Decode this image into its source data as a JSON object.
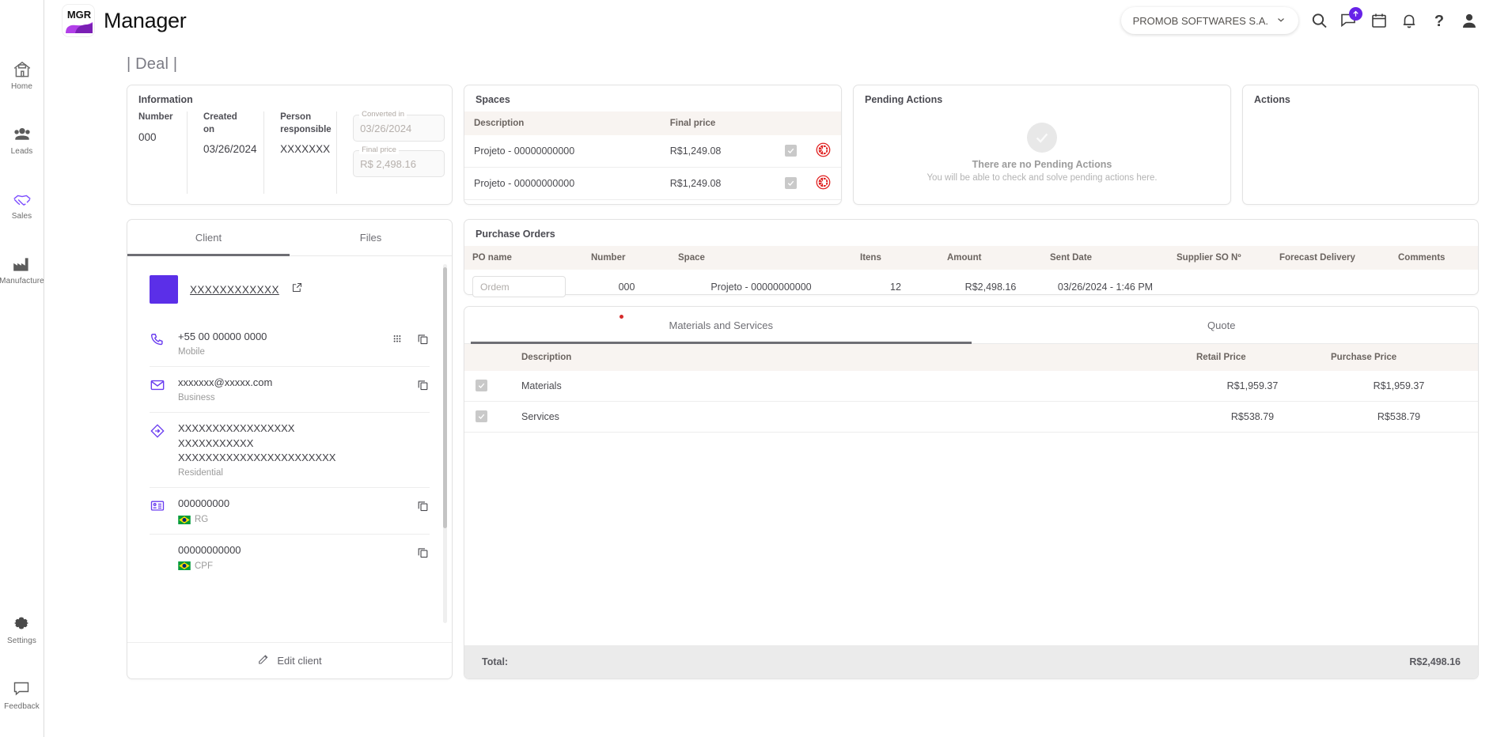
{
  "app": {
    "logo_text": "MGR",
    "title": "Manager"
  },
  "sidebar": {
    "items": [
      {
        "label": "Home",
        "icon": "home-icon"
      },
      {
        "label": "Leads",
        "icon": "people-icon"
      },
      {
        "label": "Sales",
        "icon": "handshake-icon"
      },
      {
        "label": "Manufacture",
        "icon": "factory-icon"
      }
    ],
    "bottom_items": [
      {
        "label": "Settings",
        "icon": "gear-icon"
      },
      {
        "label": "Feedback",
        "icon": "speech-bubble-icon"
      }
    ],
    "active": "Sales"
  },
  "header": {
    "org": "PROMOB SOFTWARES S.A.",
    "icons": [
      "search-icon",
      "chat-upload-icon",
      "calendar-icon",
      "bell-icon",
      "help-icon",
      "avatar-icon"
    ],
    "badge_color": "#6722e8"
  },
  "page": {
    "title": "| Deal |"
  },
  "information": {
    "title": "Information",
    "fields": [
      {
        "label": "Number",
        "value": "000"
      },
      {
        "label": "Created on",
        "value": "03/26/2024"
      },
      {
        "label": "Person responsible",
        "value": "XXXXXXX"
      }
    ],
    "converted_in": {
      "caption": "Converted in",
      "value": "03/26/2024"
    },
    "final_price": {
      "caption": "Final price",
      "value": "R$ 2,498.16"
    }
  },
  "spaces": {
    "title": "Spaces",
    "columns": [
      "Description",
      "Final price"
    ],
    "rows": [
      {
        "description": "Projeto - 00000000000",
        "final_price": "R$1,249.08"
      },
      {
        "description": "Projeto - 00000000000",
        "final_price": "R$1,249.08"
      }
    ]
  },
  "pending_actions": {
    "title": "Pending Actions",
    "empty_title": "There are no Pending Actions",
    "empty_subtitle": "You will be able to check and solve pending actions here."
  },
  "actions": {
    "title": "Actions"
  },
  "client_panel": {
    "tabs": [
      {
        "label": "Client",
        "active": true
      },
      {
        "label": "Files",
        "active": false
      }
    ],
    "name": "XXXXXXXXXXXX",
    "contacts": [
      {
        "icon": "phone-icon",
        "value": "+55 00 00000 0000",
        "sub": "Mobile",
        "actions": [
          "dialpad-icon",
          "copy-icon"
        ]
      },
      {
        "icon": "mail-icon",
        "value": "xxxxxxx@xxxxx.com",
        "sub": "Business",
        "actions": [
          "copy-icon"
        ]
      }
    ],
    "address": {
      "icon": "location-icon",
      "lines": [
        "XXXXXXXXXXXXXXXXX",
        "XXXXXXXXXXX",
        "XXXXXXXXXXXXXXXXXXXXXXX"
      ],
      "sub": "Residential"
    },
    "documents": [
      {
        "icon": "document-icon",
        "value": "000000000",
        "type": "RG",
        "flag": "brazil-flag",
        "actions": [
          "copy-icon"
        ]
      },
      {
        "icon": "",
        "value": "00000000000",
        "type": "CPF",
        "flag": "brazil-flag",
        "actions": [
          "copy-icon"
        ]
      }
    ],
    "footer_button": "Edit client"
  },
  "purchase_orders": {
    "title": "Purchase Orders",
    "columns": [
      "PO name",
      "Number",
      "Space",
      "Itens",
      "Amount",
      "Sent Date",
      "Supplier SO Nº",
      "Forecast Delivery",
      "Comments"
    ],
    "rows": [
      {
        "po_name_placeholder": "Ordem",
        "po_name_value": "",
        "number": "000",
        "space": "Projeto - 00000000000",
        "itens": "12",
        "amount": "R$2,498.16",
        "sent_date": "03/26/2024 - 1:46 PM",
        "supplier_so": "",
        "forecast_delivery": "",
        "comments": ""
      }
    ]
  },
  "materials_panel": {
    "tabs": [
      {
        "label": "Materials and Services",
        "active": true,
        "has_dot": true
      },
      {
        "label": "Quote",
        "active": false,
        "has_dot": false
      }
    ],
    "columns": [
      "Description",
      "Retail Price",
      "Purchase Price"
    ],
    "rows": [
      {
        "description": "Materials",
        "retail_price": "R$1,959.37",
        "purchase_price": "R$1,959.37",
        "checked": true
      },
      {
        "description": "Services",
        "retail_price": "R$538.79",
        "purchase_price": "R$538.79",
        "checked": true
      }
    ],
    "total_label": "Total:",
    "total_value": "R$2,498.16"
  }
}
